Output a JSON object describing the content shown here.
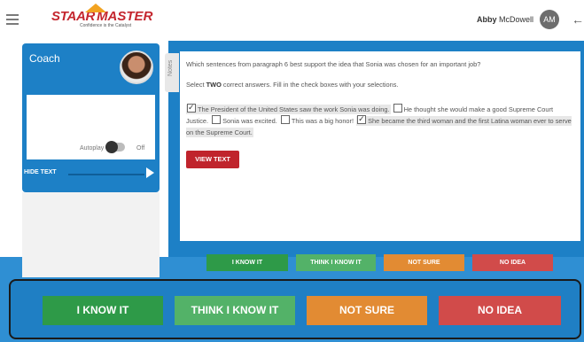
{
  "header": {
    "logo_word1": "STAAR",
    "logo_word2": "MASTER",
    "logo_tagline": "Confidence is the Catalyst",
    "user_first": "Abby",
    "user_last": "McDowell",
    "initials": "AM"
  },
  "coach": {
    "title": "Coach",
    "autoplay": "Autoplay",
    "off": "Off",
    "hide_text": "HIDE TEXT"
  },
  "notes_tab": "Notes",
  "question": {
    "prompt": "Which sentences from paragraph 6 best support the idea that Sonia was chosen for an important job?",
    "instr_pre": "Select ",
    "instr_bold": "TWO",
    "instr_post": " correct answers. Fill in the check boxes with your selections.",
    "options": [
      {
        "text": "The President of the United States saw the work Sonia was doing.",
        "checked": true
      },
      {
        "text": "He thought she would make a good Supreme Court Justice.",
        "checked": false
      },
      {
        "text": "Sonia was excited.",
        "checked": false
      },
      {
        "text": "This was a big honor!",
        "checked": false
      },
      {
        "text": "She became the third woman and the first Latina woman ever to serve on the Supreme Court.",
        "checked": true
      }
    ],
    "view_text": "VIEW TEXT"
  },
  "answers": {
    "know": "I KNOW IT",
    "think": "THINK I KNOW IT",
    "not_sure": "NOT SURE",
    "no_idea": "NO IDEA"
  },
  "colors": {
    "brand_blue": "#1d80c6",
    "brand_red": "#c0242c",
    "green": "#2e9a48",
    "light_green": "#53b268",
    "orange": "#e28b33",
    "red": "#d14b4a"
  }
}
